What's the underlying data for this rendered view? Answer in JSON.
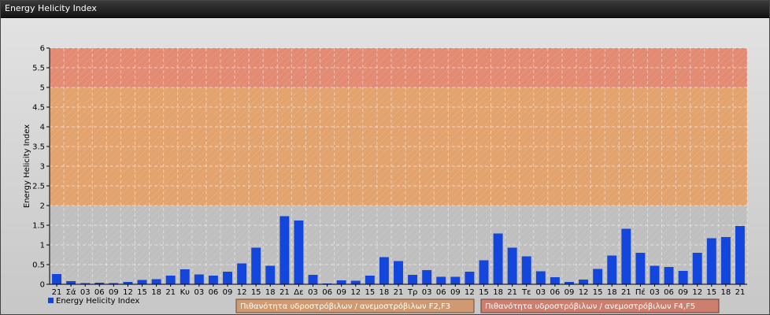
{
  "window": {
    "title": "Energy Helicity Index"
  },
  "colors": {
    "bar": "#1446dc",
    "band_low": "#bfbfbf",
    "band_mid": "#e3a36e",
    "band_high": "#e38a73",
    "legend_f23": "#cf9a72",
    "legend_f45": "#cc7f6f"
  },
  "chart_data": {
    "type": "bar",
    "ylabel": "Energy Helicity Index",
    "ylim": [
      0,
      6
    ],
    "yticks": [
      "0",
      "0.5",
      "1",
      "1.5",
      "2",
      "2.5",
      "3",
      "3.5",
      "4",
      "4.5",
      "5",
      "5.5",
      "6"
    ],
    "grid": true,
    "legend_position": "bottom",
    "categories": [
      "21",
      "Σά",
      "03",
      "06",
      "09",
      "12",
      "15",
      "18",
      "21",
      "Κυ",
      "03",
      "06",
      "09",
      "12",
      "15",
      "18",
      "21",
      "Δε",
      "03",
      "06",
      "09",
      "12",
      "15",
      "18",
      "21",
      "Τρ",
      "03",
      "06",
      "09",
      "12",
      "15",
      "18",
      "21",
      "Τε",
      "03",
      "06",
      "09",
      "12",
      "15",
      "18",
      "21",
      "Πέ",
      "03",
      "06",
      "09",
      "12",
      "15",
      "18",
      "21"
    ],
    "series": [
      {
        "name": "Energy Helicity Index",
        "values": [
          0.26,
          0.08,
          0.03,
          0.04,
          0.03,
          0.06,
          0.11,
          0.13,
          0.22,
          0.38,
          0.25,
          0.22,
          0.32,
          0.53,
          0.93,
          0.47,
          1.73,
          1.62,
          0.24,
          0.02,
          0.1,
          0.09,
          0.22,
          0.69,
          0.59,
          0.24,
          0.36,
          0.19,
          0.19,
          0.32,
          0.61,
          1.29,
          0.93,
          0.71,
          0.33,
          0.18,
          0.06,
          0.12,
          0.39,
          0.73,
          1.41,
          0.8,
          0.47,
          0.44,
          0.34,
          0.8,
          1.17,
          1.2,
          1.48
        ]
      }
    ],
    "bands": [
      {
        "from": 0,
        "to": 2,
        "label": ""
      },
      {
        "from": 2,
        "to": 5,
        "label": "Πιθανότητα υδροστρόβιλων / ανεμοστρόβιλων F2,F3"
      },
      {
        "from": 5,
        "to": 6,
        "label": "Πιθανότητα υδροστρόβιλων / ανεμοστρόβιλων F4,F5"
      }
    ]
  }
}
